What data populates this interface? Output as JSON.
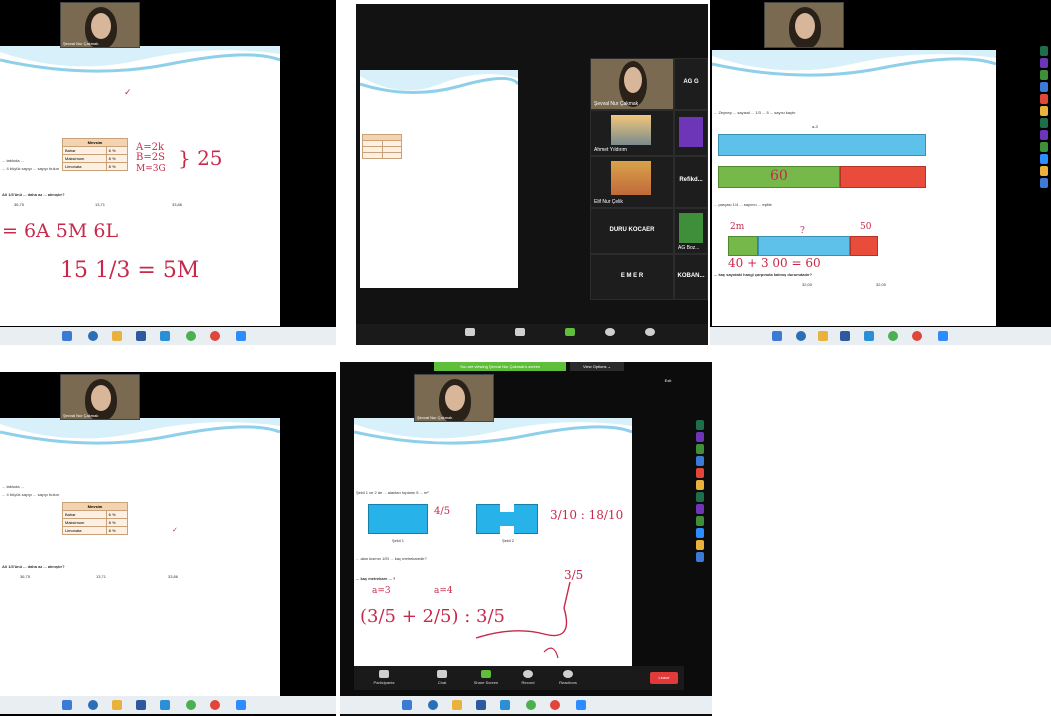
{
  "panel1": {
    "presenter_name": "Şevval Nur Çakmak",
    "lines": [
      "... tabloda ...",
      "... 4 büyük sayıyı ... sayıyı bulun"
    ],
    "table": {
      "header": "Mevsim",
      "rows": [
        {
          "label": "Bahar",
          "value": "6 %"
        },
        {
          "label": "Maksimum",
          "value": "8 %"
        },
        {
          "label": "Limonata",
          "value": "8 %"
        }
      ]
    },
    "question": "Ali 1/3'ünü ... daha az ... almıştır?",
    "options": [
      "36,75",
      "13,71",
      "33,86"
    ],
    "handwriting": {
      "right_a": "A=2k",
      "right_b": "B=2S",
      "right_c": "M=3G",
      "brace": "} 25",
      "line1": "= 6A   5M   6L",
      "line2": "15 1/3 = 5M"
    }
  },
  "panel2": {
    "video_tiles": [
      {
        "name": "Şevval Nur Çakmak"
      },
      {
        "name": "Ahmet Yıldırım"
      },
      {
        "name": "Elif Nur Çelik"
      },
      {
        "name": "DURU KOCAER"
      },
      {
        "name": "E M E R"
      }
    ],
    "right_column": [
      {
        "label": "AG G"
      },
      {
        "label": "Refikd..."
      },
      {
        "label": "AG Boz..."
      },
      {
        "label": "KOBAN..."
      }
    ],
    "bottom_center": "DURU KOCAER"
  },
  "panel3": {
    "question_line": "... Zeynep ... sayısal ... 1/3 ... 5 ... sayısı kaçtır",
    "bar_top_label": "a-3",
    "bar2_text": "60",
    "question2": "... parçası 1/4 ... sayının ... eşittir",
    "hand_labels": [
      "2m",
      "?",
      "50"
    ],
    "bottom_hand": "40 + 3 00 = 60",
    "question3": "... kaç sayıdaki hangi çarpımda kalmış durumdadır?",
    "options": [
      "32,00",
      "32,00"
    ]
  },
  "panel4": {
    "presenter_name": "Şevval Nur Çakmak",
    "lines": [
      "... tabloda ...",
      "... 4 büyük sayıyı ... sayıyı bulun"
    ],
    "table": {
      "header": "Mevsim",
      "rows": [
        {
          "label": "Bahar",
          "value": "6 %"
        },
        {
          "label": "Maksimum",
          "value": "8 %"
        },
        {
          "label": "Limonata",
          "value": "8 %"
        }
      ]
    },
    "question": "Ali 1/3'ünü ... daha az ... almıştır?",
    "options": [
      "36,75",
      "13,71",
      "33,86"
    ]
  },
  "panel5": {
    "banner": "You are viewing Şevval Nur Çakmak's screen",
    "view_options": "View Options ⌄",
    "exit": "Exit",
    "presenter_name": "Şevval Nur Çakmak",
    "line1": "Şekil 1 ve 2 de ... alanları toplamı 5 ... m²",
    "shape1_caption": "Şekil 1",
    "shape2_caption": "Şekil 2",
    "frac_mid": "4/5",
    "frac_right": "3/10 : 18/10",
    "question": "... alan kısmın 1/5'i ... kaç metrekaredir?",
    "sub_question": "... kaç metrekare ... ?",
    "hand_a": "a=3",
    "hand_b": "a=4",
    "hand_big": "(3/5 + 2/5) : 3/5",
    "hand_right": "3/5",
    "toolbar": [
      "Participants",
      "Chat",
      "Share Screen",
      "Record",
      "Reactions"
    ],
    "end": "Leave"
  },
  "colors": {
    "accent_pink": "#c8284a",
    "slide_wave": "#8ed0ea",
    "bar_blue": "#5ec1ea",
    "bar_green": "#76b94a",
    "bar_red": "#e94c3a",
    "zoom_green": "#5fbf3a",
    "leave_red": "#e03a3a"
  }
}
